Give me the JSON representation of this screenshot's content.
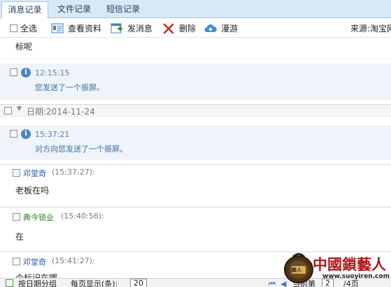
{
  "tabs": [
    {
      "label": "消息记录",
      "active": true
    },
    {
      "label": "文件记录",
      "active": false
    },
    {
      "label": "短信记录",
      "active": false
    }
  ],
  "toolbar": {
    "select_all": "全选",
    "view_profile": "查看资料",
    "send_message": "发消息",
    "delete": "删除",
    "roam": "漫游",
    "source": "来源:淘宝网"
  },
  "log": {
    "top_fragment": "标呢",
    "entry1": {
      "time": "12:15:15",
      "text": "您发送了一个振屏。"
    },
    "date_header": "日期:2014-11-24",
    "entry2": {
      "time": "15:37:21",
      "text": "对方向您发送了一个振屏。"
    },
    "msg1": {
      "name": "邓堂奇",
      "time": "(15:37:27):",
      "text": "老板在吗"
    },
    "msg2": {
      "name": "典今锁业",
      "time": "(15:40:56):",
      "text": "在"
    },
    "msg3": {
      "name": "邓堂奇",
      "time": "(15:41:27):",
      "text": "个标识在哪"
    }
  },
  "status": {
    "group_by_date": "按日期分组",
    "per_page_label": "每页显示(条):",
    "per_page_value": "20",
    "current_page_label": "当前第",
    "current_page_value": "2",
    "total_pages": "/4页"
  },
  "watermark": {
    "brand": "中國鎖藝人",
    "url": "www.suoyiren.com",
    "logo_text": "鎖人"
  },
  "colors": {
    "tab_bar": "#d9e8f6",
    "system_row": "#eef4fa",
    "name_blue": "#2456a1",
    "name_green": "#2e7a14",
    "brand_red": "#b0171c"
  }
}
